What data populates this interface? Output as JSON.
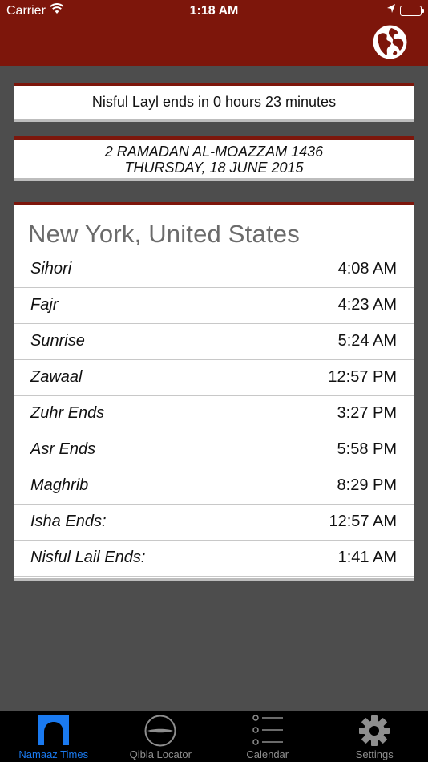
{
  "status_bar": {
    "carrier": "Carrier",
    "time": "1:18 AM"
  },
  "nav": {
    "globe_icon": "globe-icon"
  },
  "countdown": {
    "text": "Nisful Layl ends in 0 hours 23 minutes"
  },
  "date": {
    "hijri": "2 RAMADAN AL-MOAZZAM 1436",
    "gregorian": "THURSDAY, 18 JUNE 2015"
  },
  "location": {
    "city": "New York, United States"
  },
  "prayer_times": [
    {
      "name": "Sihori",
      "time": "4:08 AM"
    },
    {
      "name": "Fajr",
      "time": "4:23 AM"
    },
    {
      "name": "Sunrise",
      "time": "5:24 AM"
    },
    {
      "name": "Zawaal",
      "time": "12:57 PM"
    },
    {
      "name": "Zuhr Ends",
      "time": "3:27 PM"
    },
    {
      "name": "Asr Ends",
      "time": "5:58 PM"
    },
    {
      "name": "Maghrib",
      "time": "8:29 PM"
    },
    {
      "name": "Isha Ends:",
      "time": "12:57 AM"
    },
    {
      "name": "Nisful Lail Ends:",
      "time": "1:41 AM"
    }
  ],
  "tabs": [
    {
      "label": "Namaaz Times",
      "icon": "mosque-arch-icon",
      "active": true
    },
    {
      "label": "Qibla Locator",
      "icon": "compass-icon",
      "active": false
    },
    {
      "label": "Calendar",
      "icon": "list-icon",
      "active": false
    },
    {
      "label": "Settings",
      "icon": "gear-icon",
      "active": false
    }
  ],
  "colors": {
    "brand": "#7d160b",
    "background": "#4d4d4d",
    "tab_active": "#1a7af0",
    "tab_inactive": "#8e8e8e"
  }
}
